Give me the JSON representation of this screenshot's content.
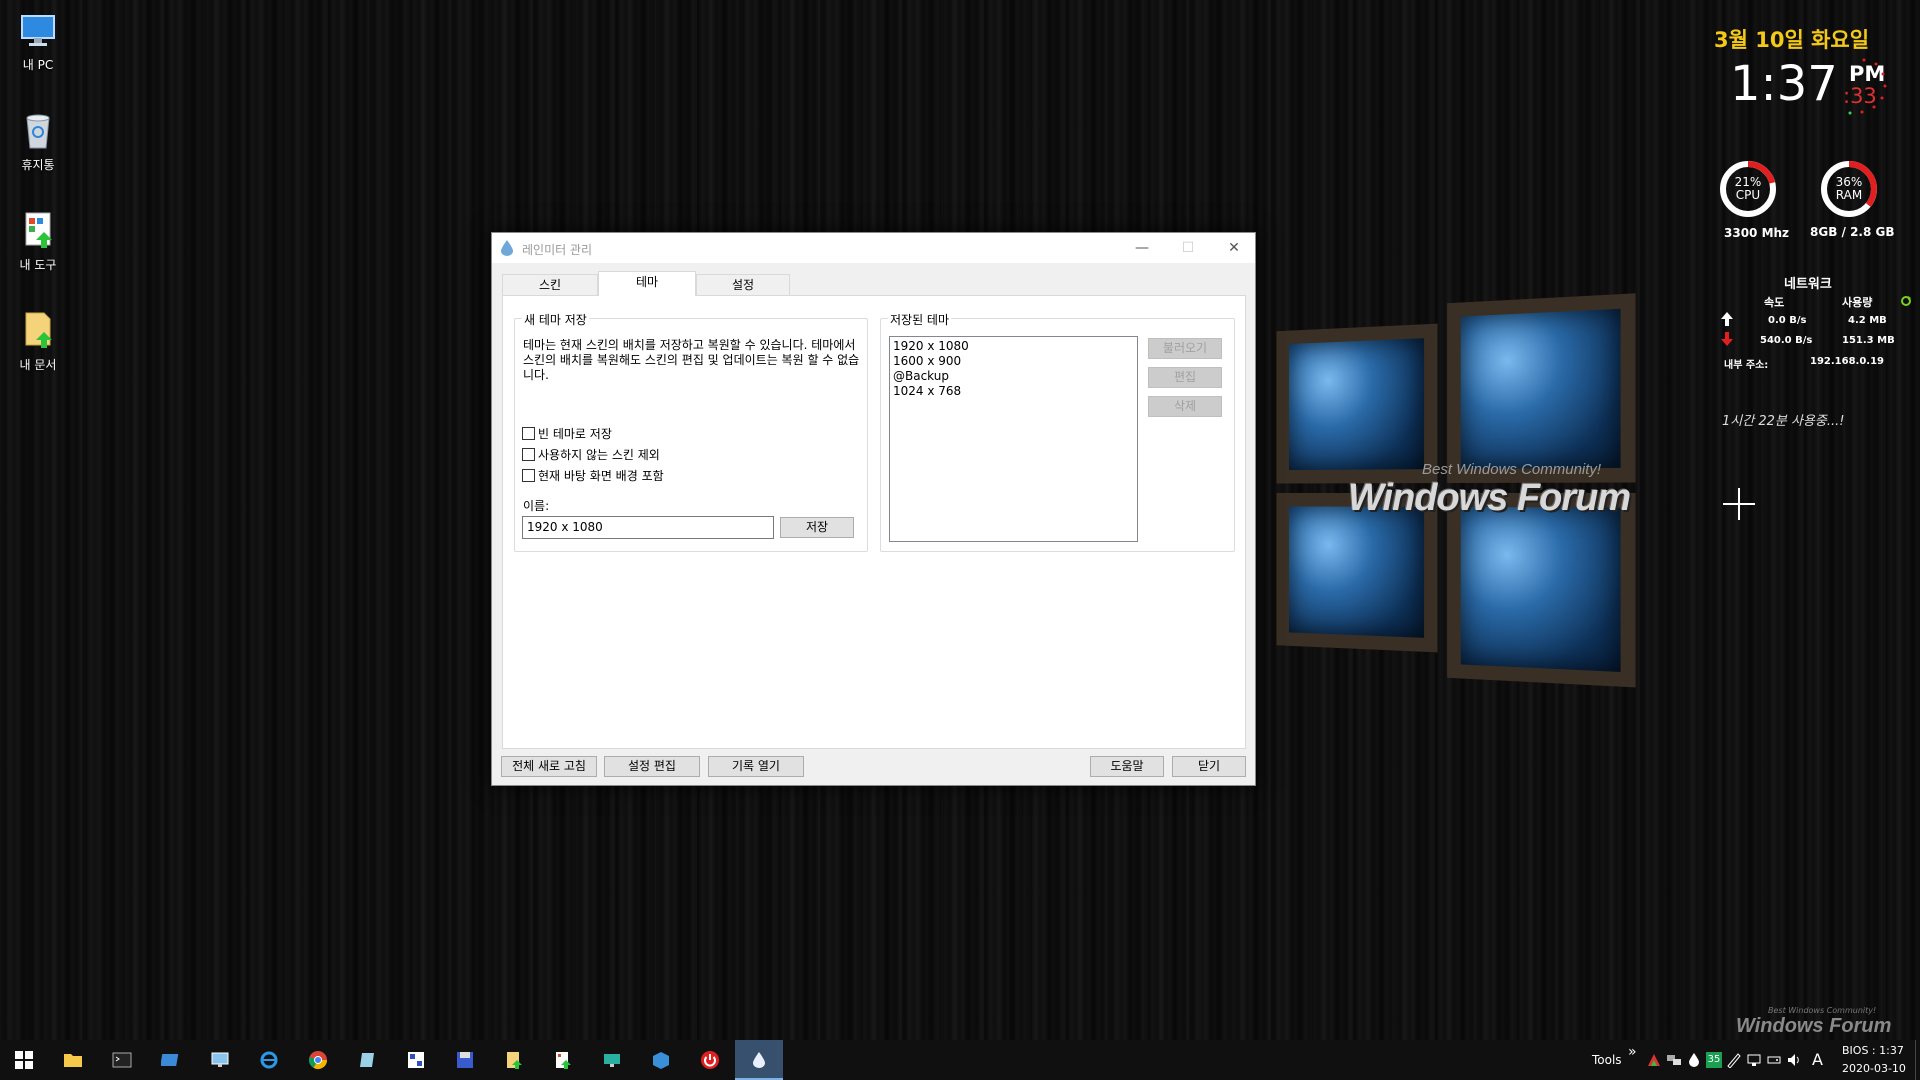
{
  "desktop": {
    "icons": [
      {
        "label": "내 PC"
      },
      {
        "label": "휴지통"
      },
      {
        "label": "내 도구"
      },
      {
        "label": "내 문서"
      }
    ]
  },
  "wallpaper": {
    "brand": "Windows Forum",
    "tagline": "Best Windows Community!"
  },
  "widgets": {
    "date": "3월 10일 화요일",
    "time": "1:37",
    "ampm": "PM",
    "seconds": ":33",
    "cpu": {
      "percent": "21%",
      "label": "CPU",
      "value": 0.21,
      "sub": "3300 Mhz"
    },
    "ram": {
      "percent": "36%",
      "label": "RAM",
      "value": 0.36,
      "sub": "8GB /  2.8 GB"
    },
    "network": {
      "title": "네트워크",
      "col_speed": "속도",
      "col_usage": "사용량",
      "up_speed": "0.0 B/s",
      "up_usage": "4.2 MB",
      "down_speed": "540.0 B/s",
      "down_usage": "151.3 MB",
      "ip_label": "내부 주소:",
      "ip_value": "192.168.0.19"
    },
    "note": "1시간 22분 사용중...!"
  },
  "dialog": {
    "title": "레인미터 관리",
    "tabs": [
      {
        "label": "스킨"
      },
      {
        "label": "테마"
      },
      {
        "label": "설정"
      }
    ],
    "new_theme": {
      "group_title": "새 테마 저장",
      "description": "테마는 현재 스킨의 배치를 저장하고 복원할 수 있습니다. 테마에서 스킨의 배치를 복원해도 스킨의 편집 및 업데이트는 복원 할 수 없습니다.",
      "options": [
        {
          "label": "빈 테마로 저장",
          "checked": false
        },
        {
          "label": "사용하지 않는 스킨 제외",
          "checked": false
        },
        {
          "label": "현재 바탕 화면 배경 포함",
          "checked": false
        }
      ],
      "name_label": "이름:",
      "name_value": "1920 x 1080",
      "save_button": "저장"
    },
    "saved_themes": {
      "group_title": "저장된 테마",
      "items": [
        "1920 x 1080",
        "1600 x 900",
        "@Backup",
        "1024 x 768"
      ],
      "load_button": "불러오기",
      "edit_button": "편집",
      "delete_button": "삭제"
    },
    "footer": {
      "refresh_all": "전체 새로 고침",
      "edit_settings": "설정 편집",
      "open_log": "기록 열기",
      "help": "도움말",
      "close": "닫기"
    }
  },
  "taskbar": {
    "tools_label": "Tools",
    "chevron": "»",
    "badge_num": "35",
    "ime": "A",
    "clock_line1": "BIOS : 1:37",
    "clock_line2": "2020-03-10"
  },
  "colors": {
    "accent_yellow": "#f5c918",
    "gauge_red": "#e02020",
    "taskbar_active": "#36506e"
  }
}
